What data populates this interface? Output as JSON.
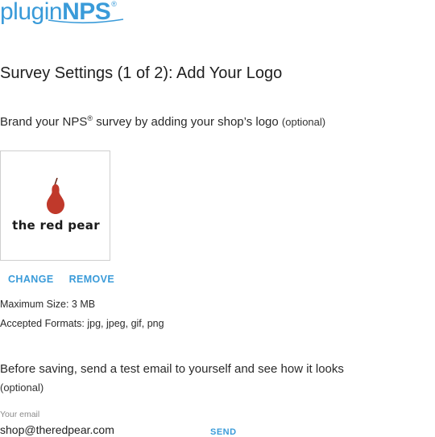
{
  "brand": {
    "prefix": "plugin",
    "suffix": "NPS",
    "registered": "®",
    "color": "#3a9bd9"
  },
  "page": {
    "title": "Survey Settings (1 of 2): Add Your Logo"
  },
  "logo_section": {
    "desc_main": "Brand your NPS",
    "desc_reg": "®",
    "desc_rest": " survey by adding your shop’s logo ",
    "desc_optional": "(optional)",
    "logo_text": "the red pear",
    "logo_color": "#c0392b",
    "change_label": "CHANGE",
    "remove_label": "REMOVE",
    "max_size": "Maximum Size: 3 MB",
    "formats": "Accepted Formats: jpg, jpeg, gif, png"
  },
  "test_email": {
    "heading": "Before saving, send a test email to yourself and see how it looks",
    "optional": "(optional)",
    "label": "Your email",
    "value": "shop@theredpear.com",
    "send_label": "SEND"
  }
}
